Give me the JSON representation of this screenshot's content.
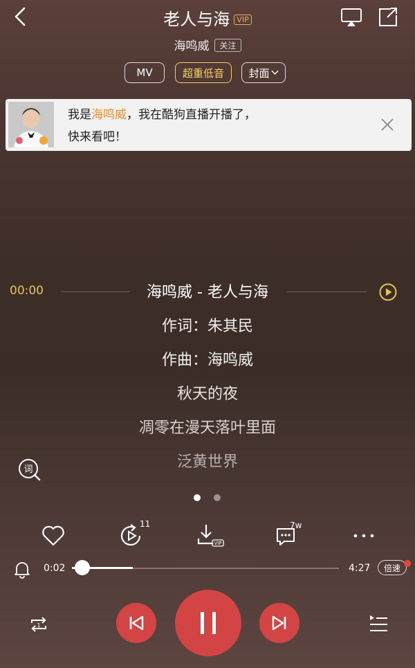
{
  "header": {
    "title": "老人与海",
    "vip_badge": "VIP",
    "artist": "海鸣威",
    "follow_label": "关注",
    "icons": [
      "back-icon",
      "screen-cast-icon",
      "share-icon"
    ]
  },
  "pills": {
    "mv": "MV",
    "bass": "超重低音",
    "cover": "封面"
  },
  "banner": {
    "prefix": "我是",
    "highlight_name": "海鸣威",
    "suffix": "，我在酷狗直播开播了，",
    "line2": "快来看吧！"
  },
  "lyrics": {
    "current_time": "00:00",
    "lines": [
      "海鸣威 - 老人与海",
      "作词：朱其民",
      "作曲：海鸣威",
      "秋天的夜",
      "凋零在漫天落叶里面",
      "泛黄世界"
    ]
  },
  "page_indicator": {
    "pages": 2,
    "active": 1
  },
  "actions": {
    "replay_count": "11",
    "comment_count": "7w",
    "download_badge": "VIP"
  },
  "progress": {
    "current": "0:02",
    "total": "4:27",
    "fraction": 0.008,
    "speed_label": "倍速"
  },
  "colors": {
    "accent_red": "#d34545",
    "gold": "#e4c35b",
    "highlight_orange": "#f08c2b"
  }
}
